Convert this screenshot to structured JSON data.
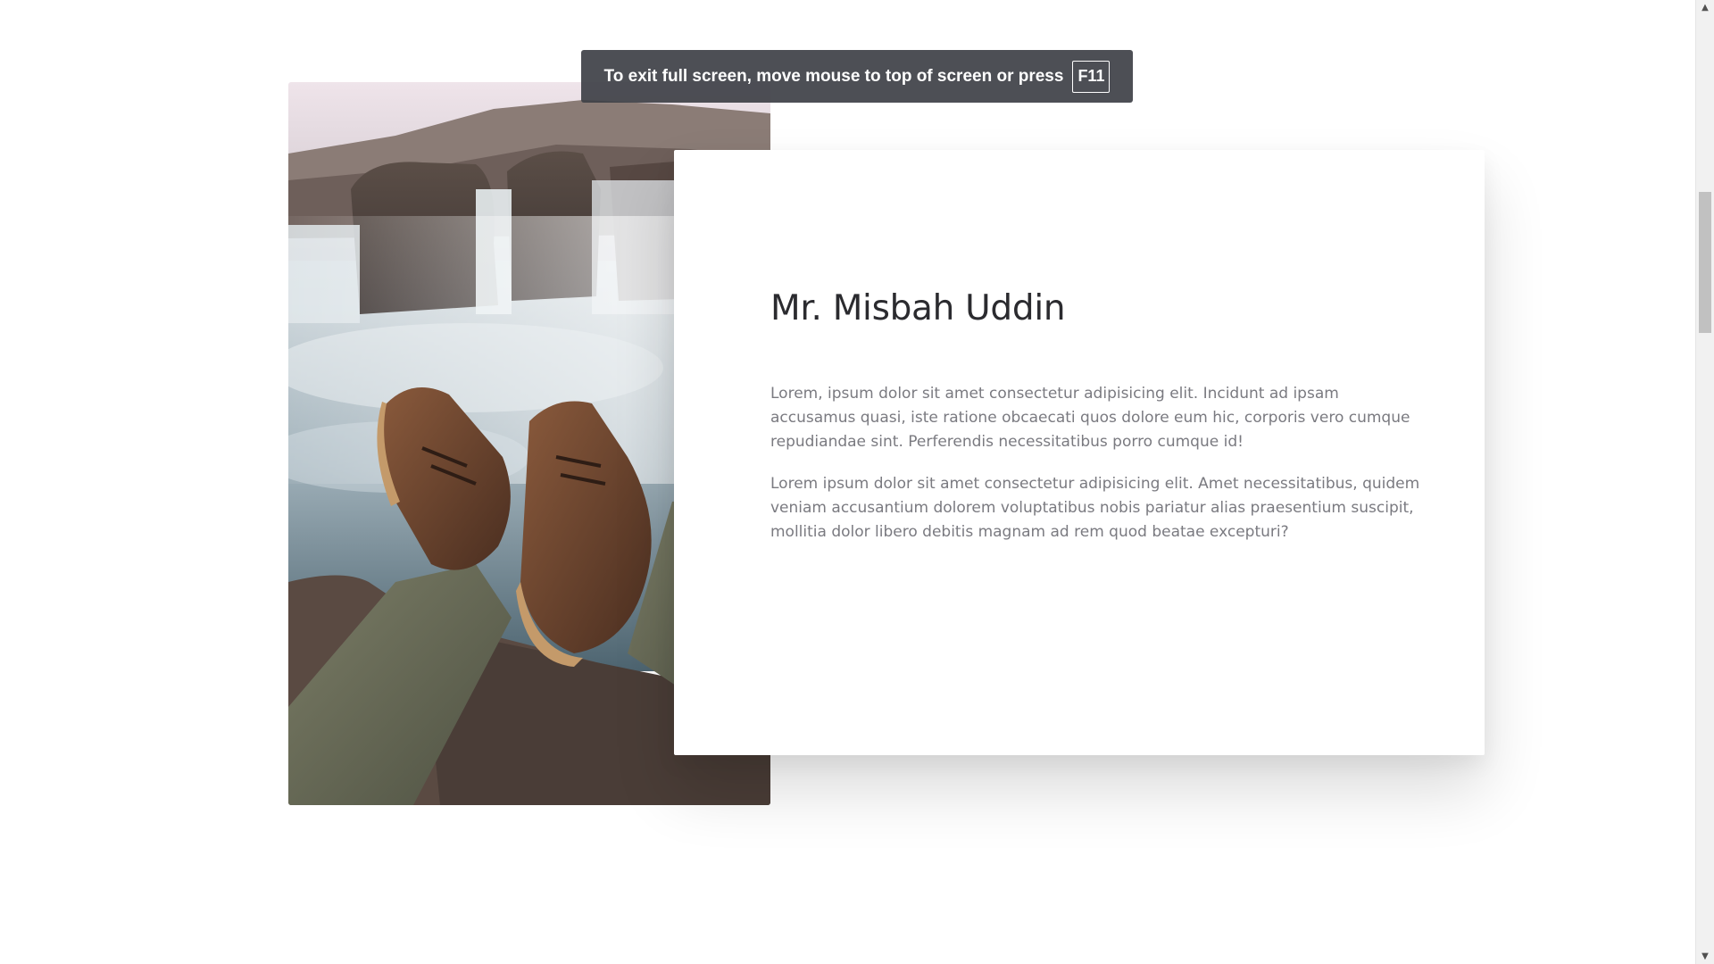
{
  "fullscreen_notice": {
    "message": "To exit full screen, move mouse to top of screen or press",
    "key": "F11"
  },
  "profile": {
    "name": "Mr. Misbah Uddin",
    "paragraphs": [
      "Lorem, ipsum dolor sit amet consectetur adipisicing elit. Incidunt ad ipsam accusamus quasi, iste ratione obcaecati quos dolore eum hic, corporis vero cumque repudiandae sint. Perferendis necessitatibus porro cumque id!",
      "Lorem ipsum dolor sit amet consectetur adipisicing elit. Amet necessitatibus, quidem veniam accusantium dolorem voluptatibus nobis pariatur alias praesentium suscipit, mollitia dolor libero debitis magnam ad rem quod beatae excepturi?"
    ],
    "image": {
      "icon": "photo-waterfall-boots"
    }
  },
  "scrollbar": {
    "up_icon": "scroll-up-arrow-icon",
    "down_icon": "scroll-down-arrow-icon"
  },
  "colors": {
    "heading": "#2b2b2f",
    "body_text": "#7a7a80",
    "notice_bg": "#3e4046"
  }
}
